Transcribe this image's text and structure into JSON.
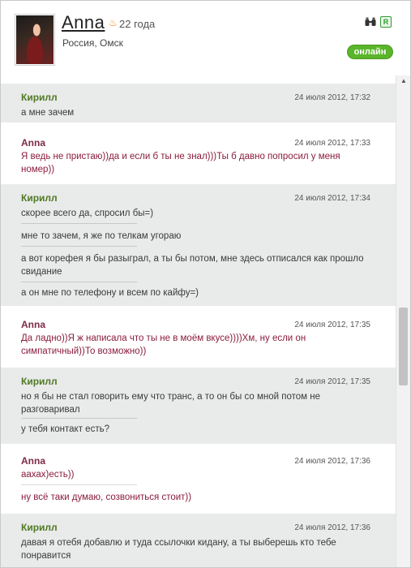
{
  "profile": {
    "name": "Anna",
    "age": "22 года",
    "location": "Россия, Омск",
    "status": "онлайн",
    "r_badge": "R"
  },
  "messages": [
    {
      "author": "Кирилл",
      "date": "24 июля 2012, 17:32",
      "lines": [
        "а мне зачем"
      ]
    },
    {
      "author": "Anna",
      "date": "24 июля 2012, 17:33",
      "lines": [
        "Я ведь не пристаю))да и если б ты не знал)))Ты б давно попросил у меня номер))"
      ]
    },
    {
      "author": "Кирилл",
      "date": "24 июля 2012, 17:34",
      "lines": [
        "скорее всего да, спросил бы=)",
        "мне то зачем, я же по телкам угораю",
        "а вот корефея я бы разыграл, а ты бы потом, мне здесь отписался как прошло свидание",
        "а он мне по телефону и всем по кайфу=)"
      ]
    },
    {
      "author": "Anna",
      "date": "24 июля 2012, 17:35",
      "lines": [
        "Да ладно))Я ж написала что ты не в моём вкусе))))Хм, ну если он симпатичный))То возможно))"
      ]
    },
    {
      "author": "Кирилл",
      "date": "24 июля 2012, 17:35",
      "lines": [
        "но я бы не стал говорить ему что транс, а то он бы со мной потом не разговаривал",
        "у тебя контакт есть?"
      ]
    },
    {
      "author": "Anna",
      "date": "24 июля 2012, 17:36",
      "lines": [
        "аахах)есть))",
        "ну всё таки думаю, созвониться стоит))"
      ]
    },
    {
      "author": "Кирилл",
      "date": "24 июля 2012, 17:36",
      "lines": [
        "давая я отебя добавлю и туда ссылочки кидану, а ты выберешь кто тебе понравится"
      ]
    }
  ],
  "colors": {
    "kirill_author": "#4e7a23",
    "anna_author": "#7d2c45",
    "online_green": "#5ab52a"
  },
  "icons": [
    "binoculars-icon",
    "age-icon",
    "scroll-up-arrow-icon"
  ]
}
